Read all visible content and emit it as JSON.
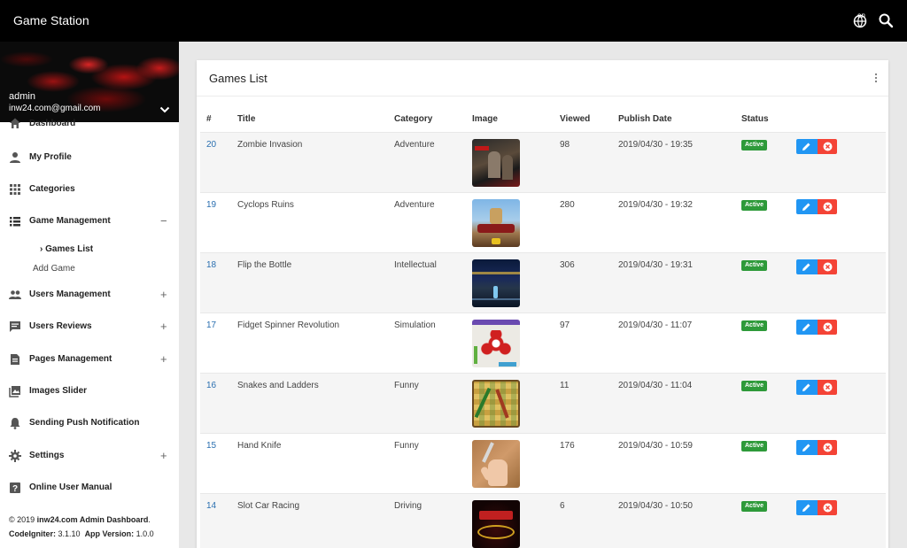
{
  "app": {
    "title": "Game Station",
    "lang": "en"
  },
  "user": {
    "name": "admin",
    "email": "inw24.com@gmail.com"
  },
  "sidebar": {
    "items": [
      {
        "label": "Dashboard",
        "icon": "home-icon",
        "toggle": ""
      },
      {
        "label": "My Profile",
        "icon": "person-icon",
        "toggle": ""
      },
      {
        "label": "Categories",
        "icon": "grid-icon",
        "toggle": ""
      },
      {
        "label": "Game Management",
        "icon": "list-icon",
        "toggle": "−"
      },
      {
        "label": "Users Management",
        "icon": "people-icon",
        "toggle": "+"
      },
      {
        "label": "Users Reviews",
        "icon": "comment-icon",
        "toggle": "+"
      },
      {
        "label": "Pages Management",
        "icon": "page-icon",
        "toggle": "+"
      },
      {
        "label": "Images Slider",
        "icon": "image-icon",
        "toggle": ""
      },
      {
        "label": "Sending Push Notification",
        "icon": "bell-icon",
        "toggle": ""
      },
      {
        "label": "Settings",
        "icon": "gear-icon",
        "toggle": "+"
      },
      {
        "label": "Online User Manual",
        "icon": "help-icon",
        "toggle": ""
      }
    ],
    "subitems": {
      "games_list": "Games List",
      "add_game": "Add Game"
    }
  },
  "footer": {
    "copyright_prefix": "© 2019 ",
    "copyright_brand": "inw24.com Admin Dashboard",
    "copyright_suffix": ".",
    "codeigniter_label": "CodeIgniter:",
    "codeigniter_version": "3.1.10",
    "app_version_label": "App Version:",
    "app_version": "1.0.0"
  },
  "card": {
    "title": "Games List"
  },
  "table": {
    "headers": [
      "#",
      "Title",
      "Category",
      "Image",
      "Viewed",
      "Publish Date",
      "Status"
    ],
    "rows": [
      {
        "id": "20",
        "title": "Zombie Invasion",
        "category": "Adventure",
        "viewed": "98",
        "date": "2019/04/30 - 19:35",
        "status": "Active"
      },
      {
        "id": "19",
        "title": "Cyclops Ruins",
        "category": "Adventure",
        "viewed": "280",
        "date": "2019/04/30 - 19:32",
        "status": "Active"
      },
      {
        "id": "18",
        "title": "Flip the Bottle",
        "category": "Intellectual",
        "viewed": "306",
        "date": "2019/04/30 - 19:31",
        "status": "Active"
      },
      {
        "id": "17",
        "title": "Fidget Spinner Revolution",
        "category": "Simulation",
        "viewed": "97",
        "date": "2019/04/30 - 11:07",
        "status": "Active"
      },
      {
        "id": "16",
        "title": "Snakes and Ladders",
        "category": "Funny",
        "viewed": "11",
        "date": "2019/04/30 - 11:04",
        "status": "Active"
      },
      {
        "id": "15",
        "title": "Hand Knife",
        "category": "Funny",
        "viewed": "176",
        "date": "2019/04/30 - 10:59",
        "status": "Active"
      },
      {
        "id": "14",
        "title": "Slot Car Racing",
        "category": "Driving",
        "viewed": "6",
        "date": "2019/04/30 - 10:50",
        "status": "Active"
      }
    ]
  },
  "colors": {
    "topbar": "#000000",
    "link": "#2a6fb0",
    "status_active": "#2e9a3a",
    "edit": "#2196f3",
    "delete": "#f44336"
  }
}
